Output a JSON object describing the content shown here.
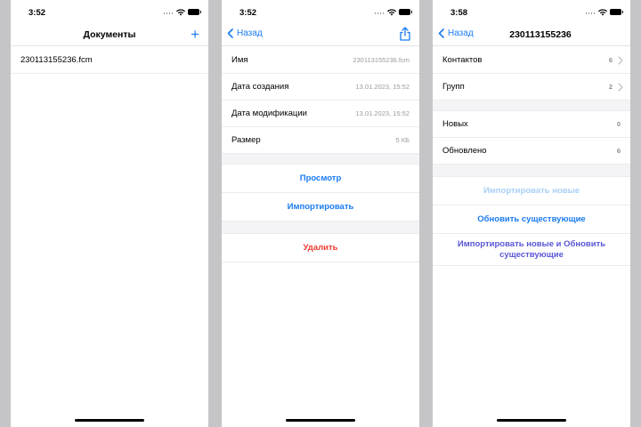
{
  "screens": [
    {
      "time": "3:52",
      "nav_title": "Документы",
      "files": [
        "230113155236.fcm"
      ]
    },
    {
      "time": "3:52",
      "back_label": "Назад",
      "info_rows": [
        {
          "label": "Имя",
          "value": "230113155236.fcm"
        },
        {
          "label": "Дата создания",
          "value": "13.01.2023, 15:52"
        },
        {
          "label": "Дата модификации",
          "value": "13.01.2023, 15:52"
        },
        {
          "label": "Размер",
          "value": "5 КБ"
        }
      ],
      "actions": {
        "view": "Просмотр",
        "import": "Импортировать",
        "delete": "Удалить"
      }
    },
    {
      "time": "3:58",
      "back_label": "Назад",
      "nav_title": "230113155236",
      "counts": [
        {
          "label": "Контактов",
          "value": "6"
        },
        {
          "label": "Групп",
          "value": "2"
        }
      ],
      "stats": [
        {
          "label": "Новых",
          "value": "0"
        },
        {
          "label": "Обновлено",
          "value": "6"
        }
      ],
      "actions": {
        "import_new": "Импортировать новые",
        "update_existing": "Обновить существующие",
        "import_and_update": "Импортировать новые и Обновить существующие"
      }
    }
  ],
  "colors": {
    "accent": "#1a7bf2",
    "destructive": "#ee3b30",
    "disabled": "#a8cff7",
    "purple": "#5856d6"
  }
}
